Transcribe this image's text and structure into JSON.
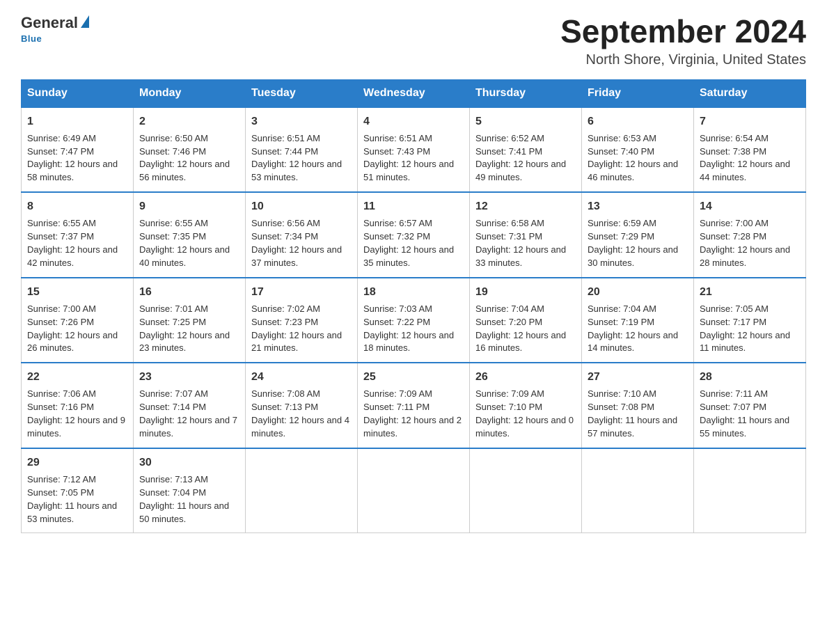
{
  "header": {
    "logo_general": "General",
    "logo_blue": "Blue",
    "month_title": "September 2024",
    "location": "North Shore, Virginia, United States"
  },
  "days_of_week": [
    "Sunday",
    "Monday",
    "Tuesday",
    "Wednesday",
    "Thursday",
    "Friday",
    "Saturday"
  ],
  "weeks": [
    [
      {
        "day": "1",
        "sunrise": "Sunrise: 6:49 AM",
        "sunset": "Sunset: 7:47 PM",
        "daylight": "Daylight: 12 hours and 58 minutes."
      },
      {
        "day": "2",
        "sunrise": "Sunrise: 6:50 AM",
        "sunset": "Sunset: 7:46 PM",
        "daylight": "Daylight: 12 hours and 56 minutes."
      },
      {
        "day": "3",
        "sunrise": "Sunrise: 6:51 AM",
        "sunset": "Sunset: 7:44 PM",
        "daylight": "Daylight: 12 hours and 53 minutes."
      },
      {
        "day": "4",
        "sunrise": "Sunrise: 6:51 AM",
        "sunset": "Sunset: 7:43 PM",
        "daylight": "Daylight: 12 hours and 51 minutes."
      },
      {
        "day": "5",
        "sunrise": "Sunrise: 6:52 AM",
        "sunset": "Sunset: 7:41 PM",
        "daylight": "Daylight: 12 hours and 49 minutes."
      },
      {
        "day": "6",
        "sunrise": "Sunrise: 6:53 AM",
        "sunset": "Sunset: 7:40 PM",
        "daylight": "Daylight: 12 hours and 46 minutes."
      },
      {
        "day": "7",
        "sunrise": "Sunrise: 6:54 AM",
        "sunset": "Sunset: 7:38 PM",
        "daylight": "Daylight: 12 hours and 44 minutes."
      }
    ],
    [
      {
        "day": "8",
        "sunrise": "Sunrise: 6:55 AM",
        "sunset": "Sunset: 7:37 PM",
        "daylight": "Daylight: 12 hours and 42 minutes."
      },
      {
        "day": "9",
        "sunrise": "Sunrise: 6:55 AM",
        "sunset": "Sunset: 7:35 PM",
        "daylight": "Daylight: 12 hours and 40 minutes."
      },
      {
        "day": "10",
        "sunrise": "Sunrise: 6:56 AM",
        "sunset": "Sunset: 7:34 PM",
        "daylight": "Daylight: 12 hours and 37 minutes."
      },
      {
        "day": "11",
        "sunrise": "Sunrise: 6:57 AM",
        "sunset": "Sunset: 7:32 PM",
        "daylight": "Daylight: 12 hours and 35 minutes."
      },
      {
        "day": "12",
        "sunrise": "Sunrise: 6:58 AM",
        "sunset": "Sunset: 7:31 PM",
        "daylight": "Daylight: 12 hours and 33 minutes."
      },
      {
        "day": "13",
        "sunrise": "Sunrise: 6:59 AM",
        "sunset": "Sunset: 7:29 PM",
        "daylight": "Daylight: 12 hours and 30 minutes."
      },
      {
        "day": "14",
        "sunrise": "Sunrise: 7:00 AM",
        "sunset": "Sunset: 7:28 PM",
        "daylight": "Daylight: 12 hours and 28 minutes."
      }
    ],
    [
      {
        "day": "15",
        "sunrise": "Sunrise: 7:00 AM",
        "sunset": "Sunset: 7:26 PM",
        "daylight": "Daylight: 12 hours and 26 minutes."
      },
      {
        "day": "16",
        "sunrise": "Sunrise: 7:01 AM",
        "sunset": "Sunset: 7:25 PM",
        "daylight": "Daylight: 12 hours and 23 minutes."
      },
      {
        "day": "17",
        "sunrise": "Sunrise: 7:02 AM",
        "sunset": "Sunset: 7:23 PM",
        "daylight": "Daylight: 12 hours and 21 minutes."
      },
      {
        "day": "18",
        "sunrise": "Sunrise: 7:03 AM",
        "sunset": "Sunset: 7:22 PM",
        "daylight": "Daylight: 12 hours and 18 minutes."
      },
      {
        "day": "19",
        "sunrise": "Sunrise: 7:04 AM",
        "sunset": "Sunset: 7:20 PM",
        "daylight": "Daylight: 12 hours and 16 minutes."
      },
      {
        "day": "20",
        "sunrise": "Sunrise: 7:04 AM",
        "sunset": "Sunset: 7:19 PM",
        "daylight": "Daylight: 12 hours and 14 minutes."
      },
      {
        "day": "21",
        "sunrise": "Sunrise: 7:05 AM",
        "sunset": "Sunset: 7:17 PM",
        "daylight": "Daylight: 12 hours and 11 minutes."
      }
    ],
    [
      {
        "day": "22",
        "sunrise": "Sunrise: 7:06 AM",
        "sunset": "Sunset: 7:16 PM",
        "daylight": "Daylight: 12 hours and 9 minutes."
      },
      {
        "day": "23",
        "sunrise": "Sunrise: 7:07 AM",
        "sunset": "Sunset: 7:14 PM",
        "daylight": "Daylight: 12 hours and 7 minutes."
      },
      {
        "day": "24",
        "sunrise": "Sunrise: 7:08 AM",
        "sunset": "Sunset: 7:13 PM",
        "daylight": "Daylight: 12 hours and 4 minutes."
      },
      {
        "day": "25",
        "sunrise": "Sunrise: 7:09 AM",
        "sunset": "Sunset: 7:11 PM",
        "daylight": "Daylight: 12 hours and 2 minutes."
      },
      {
        "day": "26",
        "sunrise": "Sunrise: 7:09 AM",
        "sunset": "Sunset: 7:10 PM",
        "daylight": "Daylight: 12 hours and 0 minutes."
      },
      {
        "day": "27",
        "sunrise": "Sunrise: 7:10 AM",
        "sunset": "Sunset: 7:08 PM",
        "daylight": "Daylight: 11 hours and 57 minutes."
      },
      {
        "day": "28",
        "sunrise": "Sunrise: 7:11 AM",
        "sunset": "Sunset: 7:07 PM",
        "daylight": "Daylight: 11 hours and 55 minutes."
      }
    ],
    [
      {
        "day": "29",
        "sunrise": "Sunrise: 7:12 AM",
        "sunset": "Sunset: 7:05 PM",
        "daylight": "Daylight: 11 hours and 53 minutes."
      },
      {
        "day": "30",
        "sunrise": "Sunrise: 7:13 AM",
        "sunset": "Sunset: 7:04 PM",
        "daylight": "Daylight: 11 hours and 50 minutes."
      },
      null,
      null,
      null,
      null,
      null
    ]
  ]
}
